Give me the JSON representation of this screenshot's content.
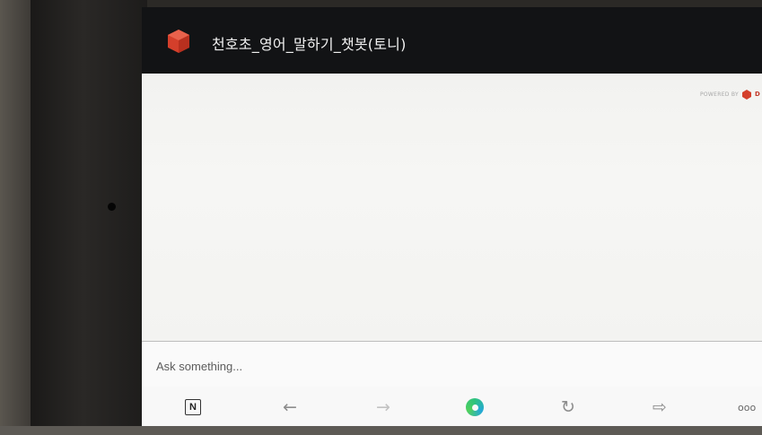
{
  "app": {
    "title": "천호초_영어_말하기_챗봇(토니)",
    "brand_color": "#d43f2b"
  },
  "powered_by": {
    "label": "POWERED BY",
    "brand": "D"
  },
  "composer": {
    "placeholder": "Ask something..."
  },
  "browser_nav": {
    "n_label": "N",
    "back_symbol": "←",
    "forward_symbol": "→",
    "reload_symbol": "↻",
    "share_symbol": "⇨",
    "more_symbol": "ooo",
    "icons": [
      "naver-icon",
      "back-arrow-icon",
      "forward-arrow-icon",
      "home-ring-icon",
      "reload-icon",
      "share-icon",
      "more-icon"
    ]
  }
}
